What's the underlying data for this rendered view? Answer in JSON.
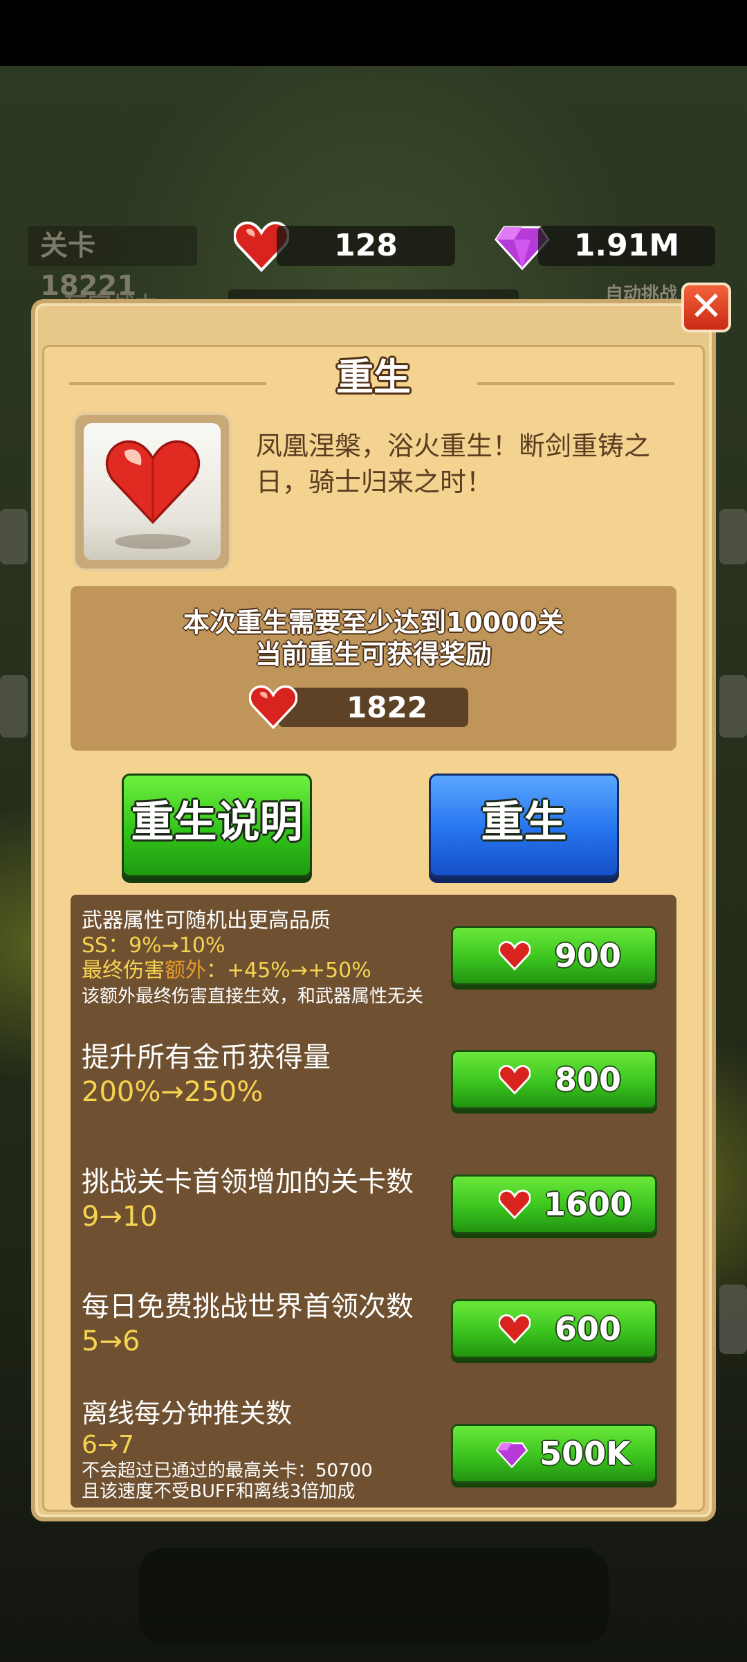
{
  "hud": {
    "level_label": "关卡",
    "level_value": "18221",
    "hearts": "128",
    "gems": "1.91M",
    "sub_left": "玩家战力",
    "sub_right": "自动挑战"
  },
  "dialog": {
    "title": "重生",
    "close": "✕",
    "description": "凤凰涅槃，浴火重生！断剑重铸之日，骑士归来之时！",
    "requirement": "本次重生需要至少达到10000关",
    "reward_label": "当前重生可获得奖励",
    "reward_value": "1822",
    "btn_info": "重生说明",
    "btn_rebirth": "重生"
  },
  "upgrades": [
    {
      "title": "武器属性可随机出更高品质",
      "line2": "SS：9%→10%",
      "line3_prefix": "最终伤害",
      "line3_highlight": "额外",
      "line3_suffix": "：+45%→+50%",
      "note": "该额外最终伤害直接生效，和武器属性无关",
      "cost": "900",
      "currency": "heart"
    },
    {
      "title": "提升所有金币获得量",
      "value": "200%→250%",
      "cost": "800",
      "currency": "heart"
    },
    {
      "title": "挑战关卡首领增加的关卡数",
      "value": "9→10",
      "cost": "1600",
      "currency": "heart"
    },
    {
      "title": "每日免费挑战世界首领次数",
      "value": "5→6",
      "cost": "600",
      "currency": "heart"
    },
    {
      "title": "离线每分钟推关数",
      "value": "6→7",
      "note1": "不会超过已通过的最高关卡：50700",
      "note2": "且该速度不受BUFF和离线3倍加成",
      "cost": "500K",
      "currency": "gem"
    }
  ],
  "colors": {
    "green_button": "#3bc41f",
    "blue_button": "#2574ee",
    "value_yellow": "#f7d352",
    "highlight_orange": "#e59a2c"
  }
}
